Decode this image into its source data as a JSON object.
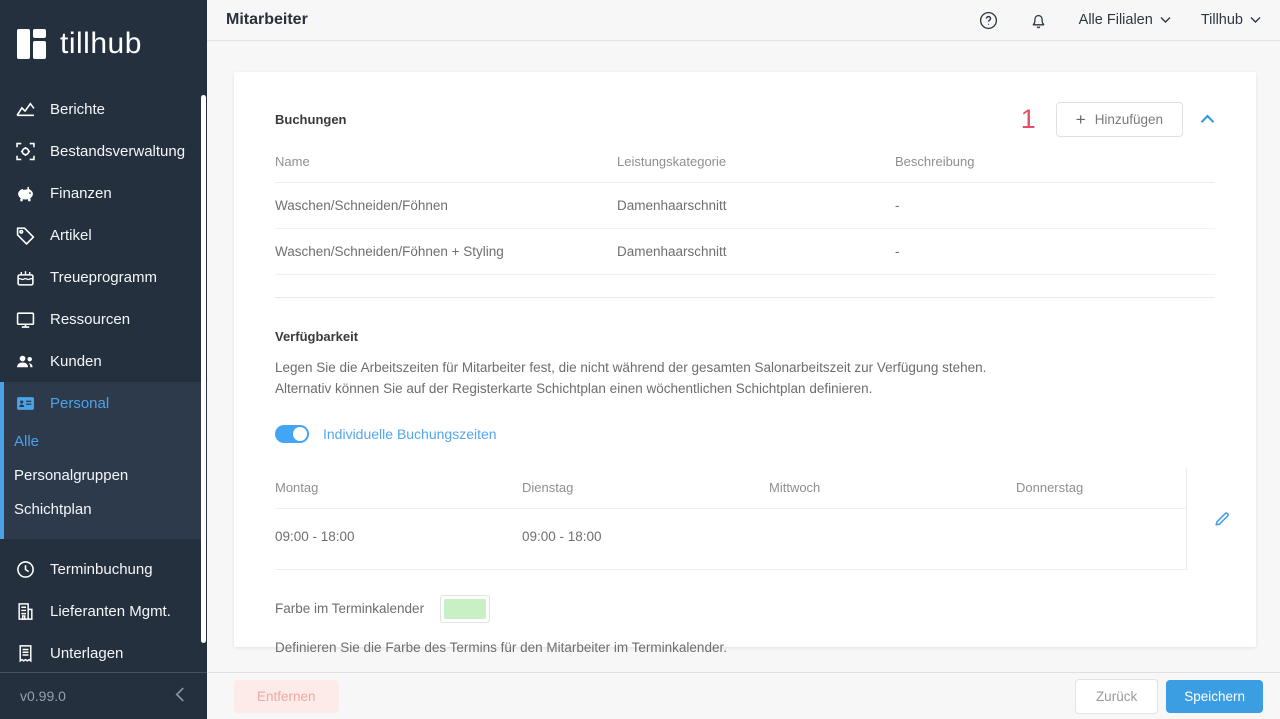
{
  "sidebar": {
    "logo_text": "tillhub",
    "items": [
      {
        "label": "Berichte",
        "icon": "chart-icon"
      },
      {
        "label": "Bestandsverwaltung",
        "icon": "inventory-scan-icon"
      },
      {
        "label": "Finanzen",
        "icon": "piggy-bank-icon"
      },
      {
        "label": "Artikel",
        "icon": "tag-icon"
      },
      {
        "label": "Treueprogramm",
        "icon": "loyalty-cake-icon"
      },
      {
        "label": "Ressourcen",
        "icon": "monitor-icon"
      },
      {
        "label": "Kunden",
        "icon": "people-icon"
      },
      {
        "label": "Personal",
        "icon": "id-card-icon",
        "active": true
      },
      {
        "label": "Terminbuchung",
        "icon": "clock-icon"
      },
      {
        "label": "Lieferanten Mgmt.",
        "icon": "building-icon"
      },
      {
        "label": "Unterlagen",
        "icon": "document-icon"
      }
    ],
    "sub_items": [
      "Alle",
      "Personalgruppen",
      "Schichtplan"
    ],
    "active_item": "Personal",
    "active_sub_item": "Alle",
    "version": "v0.99.0",
    "colors": {
      "background": "#24303e",
      "active_background": "#2c3a4c",
      "accent": "#4aa2e9"
    }
  },
  "topbar": {
    "title": "Mitarbeiter",
    "help_icon": "question-circle-icon",
    "notifications_icon": "bell-icon",
    "branch_selector": "Alle Filialen",
    "account_selector": "Tillhub"
  },
  "annotation": {
    "label": "1",
    "color": "#e14f68"
  },
  "bookings": {
    "heading": "Buchungen",
    "add_button_label": "Hinzufügen",
    "columns": [
      "Name",
      "Leistungskategorie",
      "Beschreibung"
    ],
    "rows": [
      {
        "name": "Waschen/Schneiden/Föhnen",
        "category": "Damenhaarschnitt",
        "description": "-"
      },
      {
        "name": "Waschen/Schneiden/Föhnen + Styling",
        "category": "Damenhaarschnitt",
        "description": "-"
      }
    ]
  },
  "availability": {
    "heading": "Verfügbarkeit",
    "description_line1": "Legen Sie die Arbeitszeiten für Mitarbeiter fest, die nicht während der gesamten Salonarbeitszeit zur Verfügung stehen.",
    "description_line2": "Alternativ können Sie auf der Registerkarte Schichtplan einen wöchentlichen Schichtplan definieren.",
    "toggle_label": "Individuelle Buchungszeiten",
    "toggle_on": true,
    "columns": [
      "Montag",
      "Dienstag",
      "Mittwoch",
      "Donnerstag"
    ],
    "row": [
      "09:00 - 18:00",
      "09:00 - 18:00",
      "",
      ""
    ]
  },
  "calendar_color": {
    "label": "Farbe im Terminkalender",
    "swatch_color": "#c9efc5",
    "description": "Definieren Sie die Farbe des Termins für den Mitarbeiter im Terminkalender."
  },
  "footer": {
    "remove_label": "Entfernen",
    "back_label": "Zurück",
    "save_label": "Speichern",
    "save_color": "#3b9de2"
  }
}
